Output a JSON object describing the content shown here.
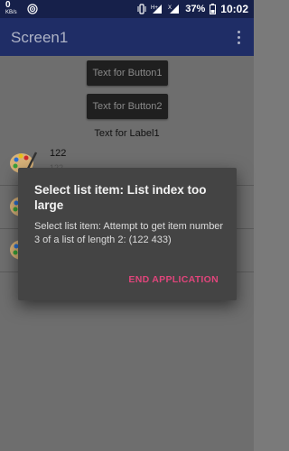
{
  "status_bar": {
    "net_speed": "0",
    "net_unit": "KB/s",
    "battery": "37%",
    "time": "10:02",
    "icons": [
      "wifi-icon",
      "vibrate-icon",
      "signal-h-plus-icon",
      "signal-x-icon",
      "battery-icon"
    ]
  },
  "app_bar": {
    "title": "Screen1"
  },
  "screen": {
    "button1_label": "Text for Button1",
    "button2_label": "Text for Button2",
    "label1": "Text for Label1",
    "list_items": [
      {
        "title": "122",
        "subtitle": "122"
      },
      {
        "title": "",
        "subtitle": ""
      },
      {
        "title": "",
        "subtitle": ""
      }
    ]
  },
  "dialog": {
    "title": "Select list item: List index too large",
    "message": "Select list item: Attempt to get item number 3 of a list of length 2: (122 433)",
    "button_label": "END APPLICATION"
  },
  "colors": {
    "status_bar": "#16204a",
    "app_bar": "#1f2d66",
    "dialog_bg": "#444444",
    "accent": "#e0457b"
  }
}
